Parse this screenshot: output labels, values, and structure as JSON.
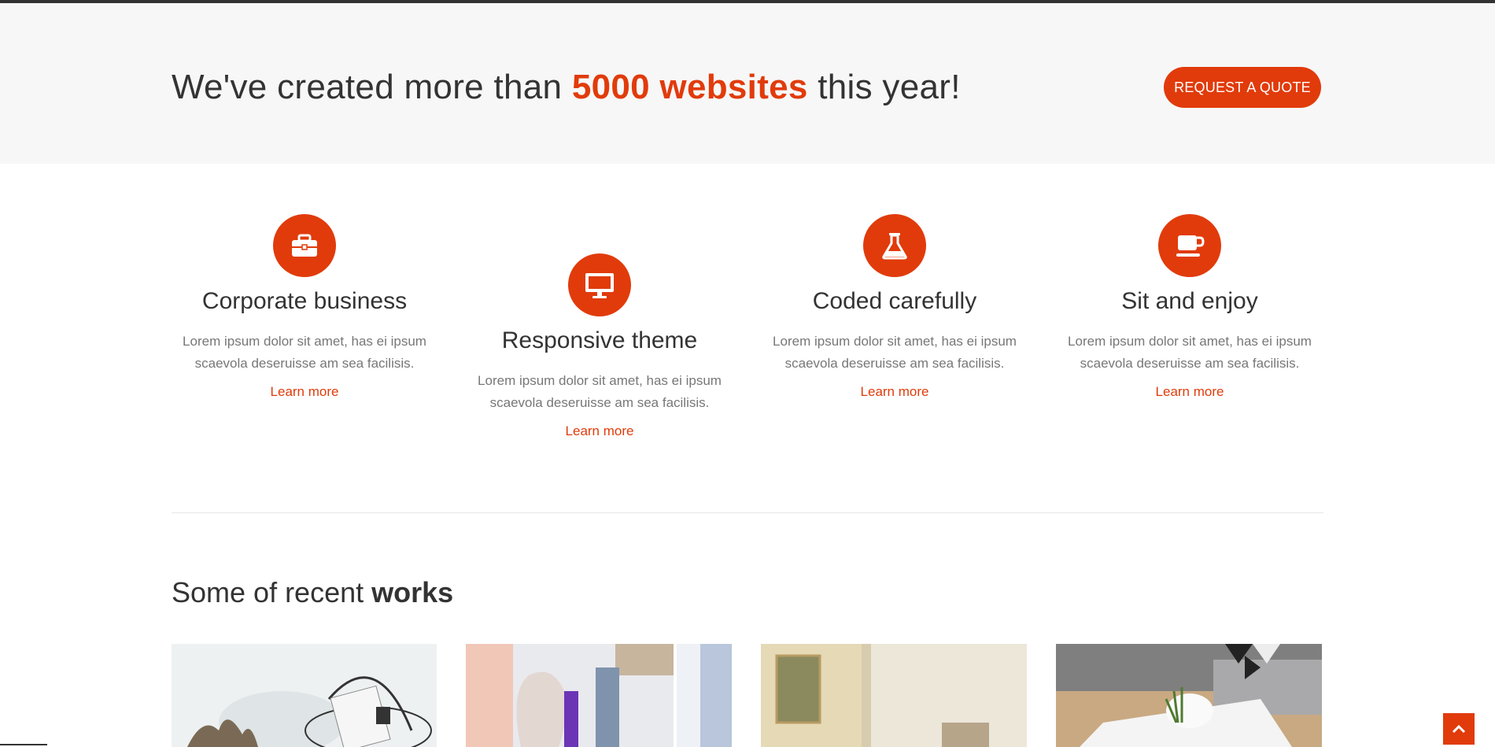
{
  "banner": {
    "title_prefix": "We've created more than ",
    "title_highlight": "5000 websites",
    "title_suffix": " this year!",
    "button_label": "REQUEST A QUOTE"
  },
  "features": [
    {
      "icon": "briefcase-icon",
      "title": "Corporate business",
      "desc": "Lorem ipsum dolor sit amet, has ei ipsum scaevola deseruisse am sea facilisis.",
      "link": "Learn more"
    },
    {
      "icon": "monitor-icon",
      "title": "Responsive theme",
      "desc": "Lorem ipsum dolor sit amet, has ei ipsum scaevola deseruisse am sea facilisis.",
      "link": "Learn more"
    },
    {
      "icon": "flask-icon",
      "title": "Coded carefully",
      "desc": "Lorem ipsum dolor sit amet, has ei ipsum scaevola deseruisse am sea facilisis.",
      "link": "Learn more"
    },
    {
      "icon": "coffee-cup-icon",
      "title": "Sit and enjoy",
      "desc": "Lorem ipsum dolor sit amet, has ei ipsum scaevola deseruisse am sea facilisis.",
      "link": "Learn more"
    }
  ],
  "works": {
    "title_prefix": "Some of recent ",
    "title_bold": "works"
  },
  "colors": {
    "accent": "#e13b0b",
    "banner_bg": "#f7f7f7",
    "text": "#333333"
  }
}
